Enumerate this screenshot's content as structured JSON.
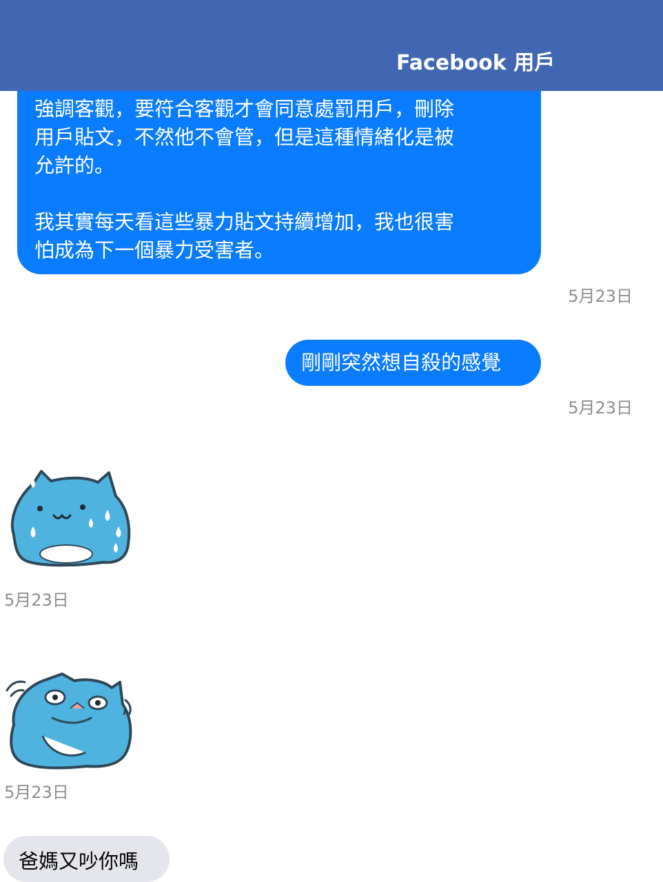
{
  "header": {
    "title": "Facebook 用戶"
  },
  "messages": [
    {
      "direction": "outgoing",
      "paragraphs": [
        "強調客觀，要符合客觀才會同意處罰用戶，刪除\n用戶貼文，不然他不會管，但是這種情緒化是被\n允許的。",
        " 我其實每天看這些暴力貼文持續增加，我也很害\n怕成為下一個暴力受害者。"
      ],
      "timestamp": "5月23日"
    },
    {
      "direction": "outgoing",
      "text": "剛剛突然想自殺的感覺",
      "timestamp": "5月23日"
    },
    {
      "direction": "incoming",
      "sticker": "blue-cat-sweating-sticker",
      "timestamp": "5月23日"
    },
    {
      "direction": "incoming",
      "sticker": "blue-cat-shivering-sticker",
      "timestamp": "5月23日"
    },
    {
      "direction": "incoming",
      "text": "爸媽又吵你嗎"
    }
  ],
  "colors": {
    "header_bg": "#4267b2",
    "outgoing_bubble": "#0a7cff",
    "incoming_bubble": "#e4e6eb",
    "timestamp": "#8a8d91",
    "sticker_blue": "#4fb3e0"
  }
}
